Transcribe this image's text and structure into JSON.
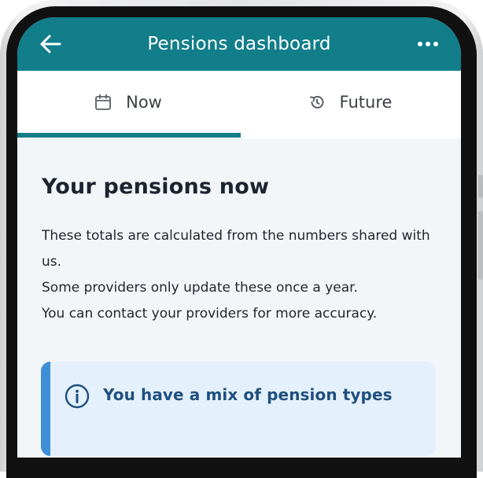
{
  "header": {
    "title": "Pensions dashboard",
    "back_icon": "back-arrow-icon",
    "more_icon": "more-options-icon",
    "color": "#117e8a"
  },
  "tabs": [
    {
      "label": "Now",
      "icon": "calendar-icon",
      "selected": true
    },
    {
      "label": "Future",
      "icon": "history-clock-icon",
      "selected": false
    }
  ],
  "main": {
    "heading": "Your pensions now",
    "intro_lines": [
      "These totals are calculated from the numbers shared with us.",
      "Some providers only update these once a year.",
      "You can contact your providers for more accuracy."
    ]
  },
  "info_card": {
    "title": "You have a mix of pension types",
    "icon": "info-icon",
    "accent_color": "#3e8fd6",
    "background": "#e4f0fb"
  }
}
